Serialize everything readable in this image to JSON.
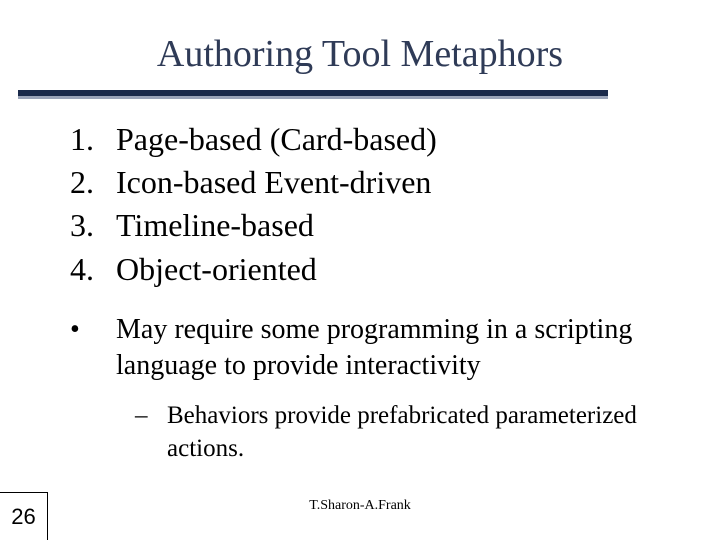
{
  "title": "Authoring Tool Metaphors",
  "numbered_items": [
    {
      "marker": "1.",
      "text": "Page-based (Card-based)"
    },
    {
      "marker": "2.",
      "text": "Icon-based Event-driven"
    },
    {
      "marker": "3.",
      "text": "Timeline-based"
    },
    {
      "marker": "4.",
      "text": "Object-oriented"
    }
  ],
  "bullet": {
    "marker": "•",
    "text": "May require some programming in a scripting language to provide interactivity"
  },
  "sub_bullet": {
    "marker": "–",
    "text": "Behaviors provide prefabricated parameterized actions."
  },
  "footer_author": "T.Sharon-A.Frank",
  "page_number": "26"
}
